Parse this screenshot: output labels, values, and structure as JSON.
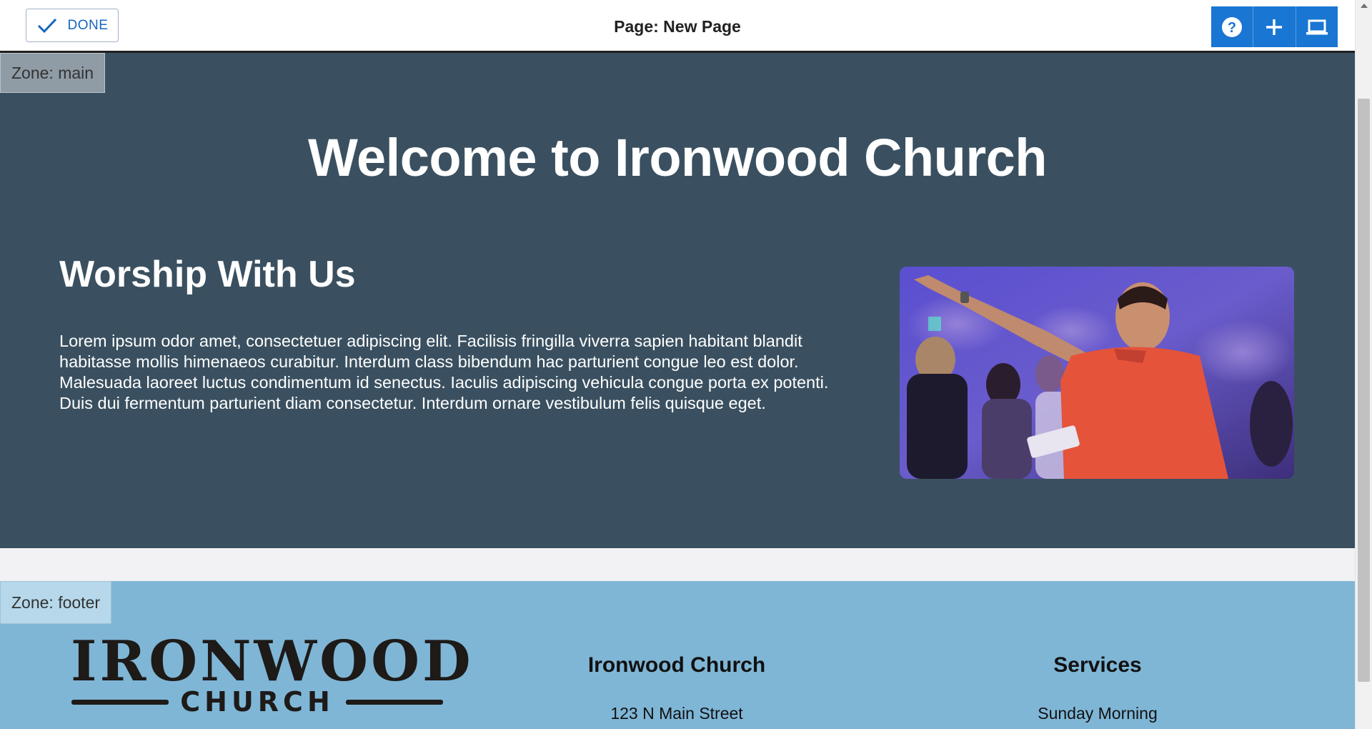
{
  "topbar": {
    "done_label": "DONE",
    "page_title": "Page: New Page",
    "tools": [
      {
        "icon": "help-icon"
      },
      {
        "icon": "plus-icon"
      },
      {
        "icon": "laptop-icon"
      }
    ]
  },
  "colors": {
    "accent": "#1976d2",
    "main_zone_bg": "#3a5060",
    "footer_zone_bg": "#7fb6d6"
  },
  "main_zone": {
    "label": "Zone: main",
    "welcome_heading": "Welcome to Ironwood Church",
    "section_heading": "Worship With Us",
    "section_body": "Lorem ipsum odor amet, consectetuer adipiscing elit. Facilisis fringilla viverra sapien habitant blandit habitasse mollis himenaeos curabitur. Interdum class bibendum hac parturient congue leo est dolor. Malesuada laoreet luctus condimentum id senectus. Iaculis adipiscing vehicula congue porta ex potenti. Duis dui fermentum parturient diam consectetur. Interdum ornare vestibulum felis quisque eget."
  },
  "footer_zone": {
    "label": "Zone: footer",
    "logo": {
      "word": "IRONWOOD",
      "sub": "CHURCH"
    },
    "church_heading": "Ironwood Church",
    "church_address": "123 N Main Street",
    "services_heading": "Services",
    "services_first": "Sunday Morning"
  }
}
